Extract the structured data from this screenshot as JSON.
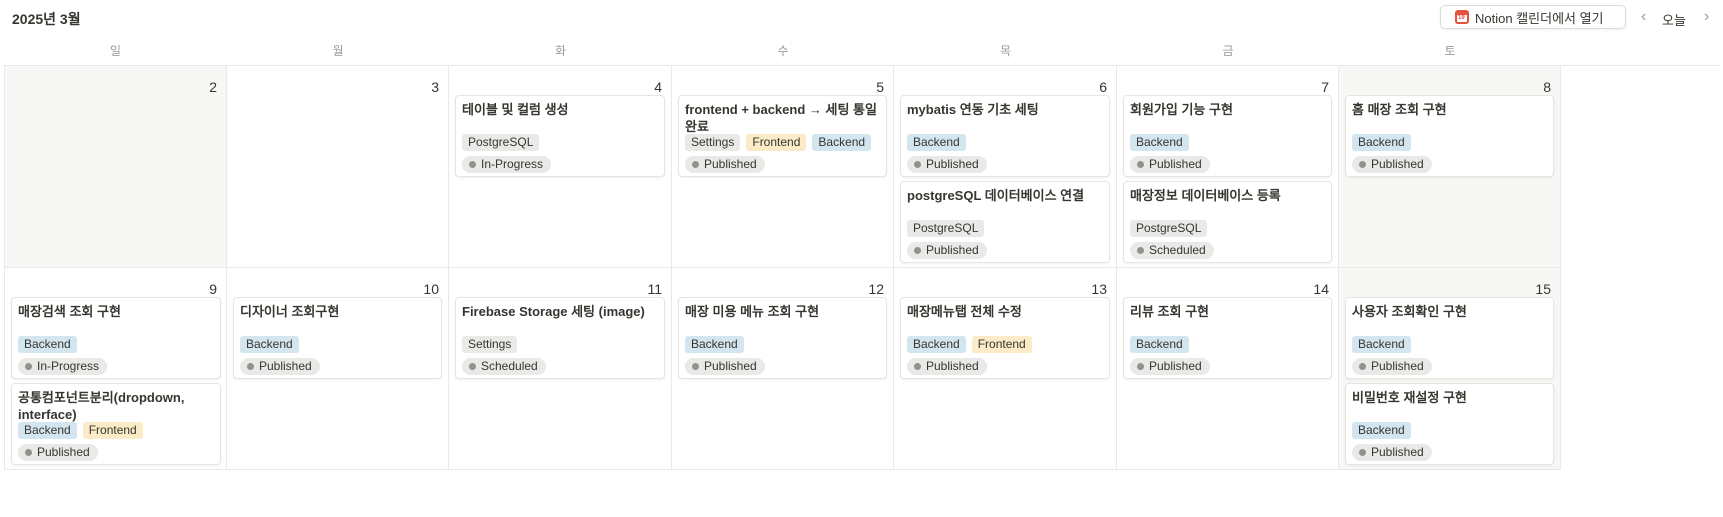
{
  "header": {
    "month": "2025년 3월",
    "open_in_notion": "Notion 캘린더에서 열기",
    "calendar_icon_day": "19",
    "today": "오늘",
    "prev_icon": "chevron-left-icon",
    "next_icon": "chevron-right-icon"
  },
  "weekdays": [
    "일",
    "월",
    "화",
    "수",
    "목",
    "금",
    "토"
  ],
  "colors": {
    "backend_tag": "#d3e5ef",
    "frontend_tag": "#fbecc7",
    "neutral_tag": "#e9e9e7",
    "weekend_bg": "#f7f7f5"
  },
  "weeks": [
    {
      "days": [
        {
          "date": "2",
          "events": []
        },
        {
          "date": "3",
          "events": []
        },
        {
          "date": "4",
          "events": [
            {
              "title": "테이블 및 컬럼 생성",
              "tags": [
                {
                  "label": "PostgreSQL",
                  "kind": "postgresql"
                }
              ],
              "status": "In-Progress"
            }
          ]
        },
        {
          "date": "5",
          "events": [
            {
              "title": "frontend + backend → 세팅 통일 완료",
              "tags": [
                {
                  "label": "Settings",
                  "kind": "settings"
                },
                {
                  "label": "Frontend",
                  "kind": "frontend"
                },
                {
                  "label": "Backend",
                  "kind": "backend"
                }
              ],
              "status": "Published"
            }
          ]
        },
        {
          "date": "6",
          "events": [
            {
              "title": "mybatis 연동 기초 세팅",
              "tags": [
                {
                  "label": "Backend",
                  "kind": "backend"
                }
              ],
              "status": "Published"
            },
            {
              "title": "postgreSQL 데이터베이스 연결",
              "tags": [
                {
                  "label": "PostgreSQL",
                  "kind": "postgresql"
                }
              ],
              "status": "Published"
            }
          ]
        },
        {
          "date": "7",
          "events": [
            {
              "title": "회원가입 기능 구현",
              "tags": [
                {
                  "label": "Backend",
                  "kind": "backend"
                }
              ],
              "status": "Published"
            },
            {
              "title": "매장정보 데이터베이스 등록",
              "tags": [
                {
                  "label": "PostgreSQL",
                  "kind": "postgresql"
                }
              ],
              "status": "Scheduled"
            }
          ]
        },
        {
          "date": "8",
          "events": [
            {
              "title": "홈 매장 조회 구현",
              "tags": [
                {
                  "label": "Backend",
                  "kind": "backend"
                }
              ],
              "status": "Published"
            }
          ]
        }
      ]
    },
    {
      "days": [
        {
          "date": "9",
          "events": [
            {
              "title": "매장검색 조회 구현",
              "tags": [
                {
                  "label": "Backend",
                  "kind": "backend"
                }
              ],
              "status": "In-Progress"
            },
            {
              "title": "공통컴포넌트분리(dropdown, interface)",
              "tags": [
                {
                  "label": "Backend",
                  "kind": "backend"
                },
                {
                  "label": "Frontend",
                  "kind": "frontend"
                }
              ],
              "status": "Published"
            }
          ]
        },
        {
          "date": "10",
          "events": [
            {
              "title": "디자이너 조회구현",
              "tags": [
                {
                  "label": "Backend",
                  "kind": "backend"
                }
              ],
              "status": "Published"
            }
          ]
        },
        {
          "date": "11",
          "events": [
            {
              "title": "Firebase Storage 세팅 (image)",
              "tags": [
                {
                  "label": "Settings",
                  "kind": "settings"
                }
              ],
              "status": "Scheduled"
            }
          ]
        },
        {
          "date": "12",
          "events": [
            {
              "title": "매장 미용 메뉴 조회 구현",
              "tags": [
                {
                  "label": "Backend",
                  "kind": "backend"
                }
              ],
              "status": "Published"
            }
          ]
        },
        {
          "date": "13",
          "events": [
            {
              "title": "매장메뉴탭 전체 수정",
              "tags": [
                {
                  "label": "Backend",
                  "kind": "backend"
                },
                {
                  "label": "Frontend",
                  "kind": "frontend"
                }
              ],
              "status": "Published"
            }
          ]
        },
        {
          "date": "14",
          "events": [
            {
              "title": "리뷰 조회 구현",
              "tags": [
                {
                  "label": "Backend",
                  "kind": "backend"
                }
              ],
              "status": "Published"
            }
          ]
        },
        {
          "date": "15",
          "events": [
            {
              "title": "사용자 조회확인 구현",
              "tags": [
                {
                  "label": "Backend",
                  "kind": "backend"
                }
              ],
              "status": "Published"
            },
            {
              "title": "비밀번호 재설정 구현",
              "tags": [
                {
                  "label": "Backend",
                  "kind": "backend"
                }
              ],
              "status": "Published"
            }
          ]
        }
      ]
    }
  ]
}
